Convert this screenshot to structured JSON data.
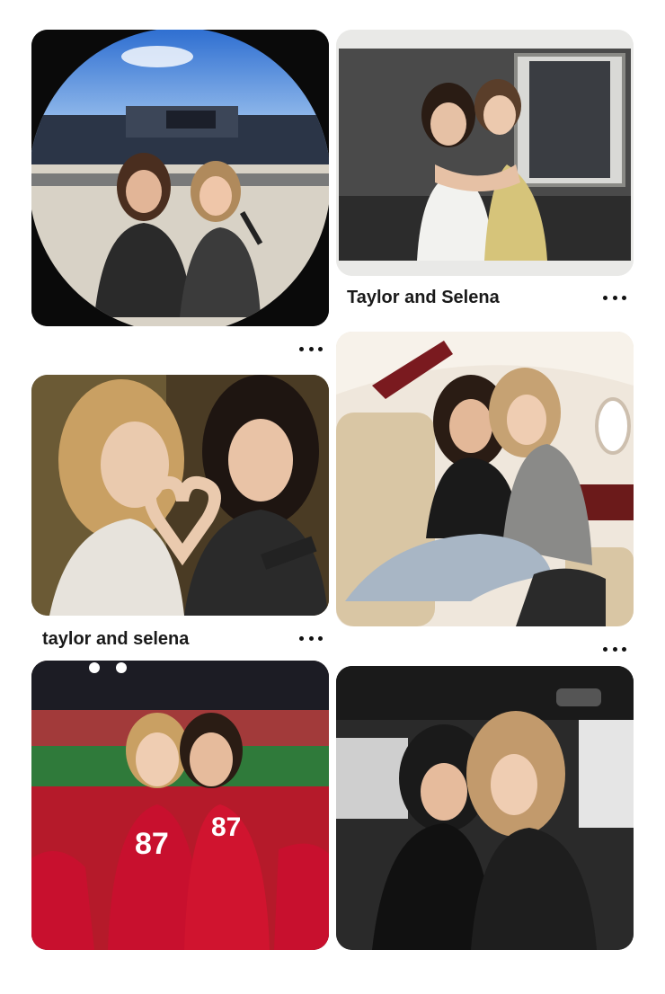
{
  "feed": {
    "pins": [
      {
        "id": "pin-1",
        "image_desc": "fisheye-stadium-selfie",
        "caption": ""
      },
      {
        "id": "pin-2",
        "image_desc": "polaroid-hug-photo",
        "caption": "Taylor and Selena"
      },
      {
        "id": "pin-3",
        "image_desc": "heart-hands-selfie",
        "caption": "taylor and selena"
      },
      {
        "id": "pin-4",
        "image_desc": "private-jet-cuddle",
        "caption": ""
      },
      {
        "id": "pin-5",
        "image_desc": "football-stadium-87-jerseys",
        "caption": ""
      },
      {
        "id": "pin-6",
        "image_desc": "car-backseat-hug",
        "caption": ""
      }
    ]
  },
  "icons": {
    "more": "more-options-icon"
  },
  "colors": {
    "background": "#ffffff",
    "text": "#1a1a1a",
    "jersey_red": "#c8102e"
  }
}
